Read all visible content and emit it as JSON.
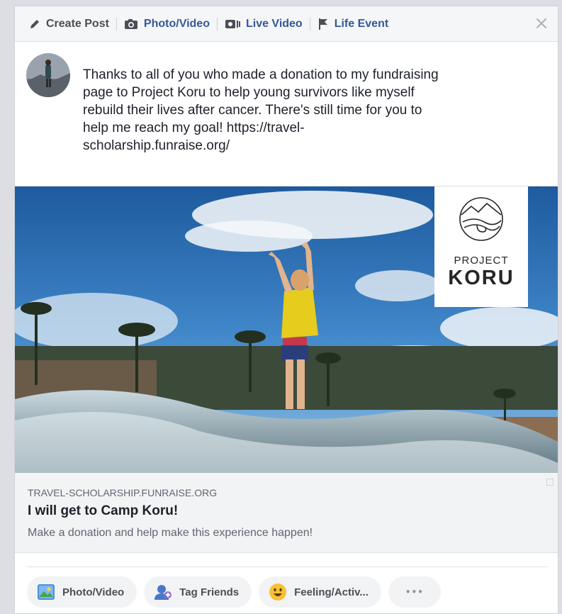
{
  "tabs": [
    {
      "label": "Create Post",
      "icon": "pencil-icon"
    },
    {
      "label": "Photo/Video",
      "icon": "camera-icon"
    },
    {
      "label": "Live Video",
      "icon": "live-video-icon"
    },
    {
      "label": "Life Event",
      "icon": "flag-icon"
    }
  ],
  "close_label": "×",
  "post": {
    "text": "Thanks to all of you who made a donation to my fundraising\npage to Project Koru to help young survivors like myself\nrebuild their lives after cancer. There's still time for you to\nhelp me reach my goal! https://travel-\nscholarship.funraise.org/"
  },
  "preview": {
    "logo_line1": "PROJECT",
    "logo_line2": "KORU",
    "domain": "TRAVEL-SCHOLARSHIP.FUNRAISE.ORG",
    "title": "I will get to Camp Koru!",
    "description": "Make a donation and help make this experience happen!"
  },
  "actions": [
    {
      "label": "Photo/Video",
      "icon": "photo-icon"
    },
    {
      "label": "Tag Friends",
      "icon": "tag-friends-icon"
    },
    {
      "label": "Feeling/Activ...",
      "icon": "feeling-emoji-icon"
    },
    {
      "label": "•••",
      "icon": "more-icon"
    }
  ],
  "colors": {
    "link_blue": "#365899",
    "text": "#1d2129",
    "muted": "#606770"
  }
}
